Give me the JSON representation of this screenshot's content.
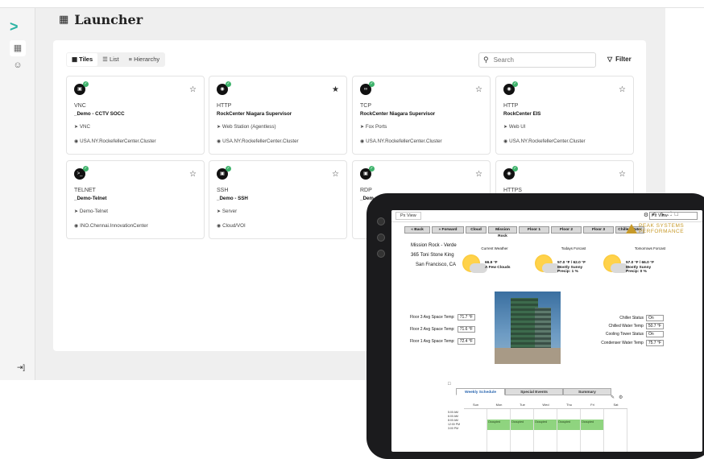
{
  "rail": {
    "items": [
      "launcher",
      "user"
    ]
  },
  "page": {
    "title": "Launcher"
  },
  "view_tabs": [
    {
      "label": "Tiles",
      "icon": "grid-icon",
      "active": true
    },
    {
      "label": "List",
      "icon": "list-icon",
      "active": false
    },
    {
      "label": "Hierarchy",
      "icon": "hierarchy-icon",
      "active": false
    }
  ],
  "search": {
    "placeholder": "Search"
  },
  "filter": {
    "label": "Filter"
  },
  "cards": [
    {
      "protocol": "VNC",
      "name": "_Demo - CCTV SOCC",
      "app": "VNC",
      "location": "USA.NY.RockefellerCenter.Cluster",
      "favorite": false
    },
    {
      "protocol": "HTTP",
      "name": "RockCenter Niagara Supervisor",
      "app": "Web Station (Agentless)",
      "location": "USA.NY.RockefellerCenter.Cluster",
      "favorite": true
    },
    {
      "protocol": "TCP",
      "name": "RockCenter Niagara Supervisor",
      "app": "Fox Ports",
      "location": "USA.NY.RockefellerCenter.Cluster",
      "favorite": false
    },
    {
      "protocol": "HTTP",
      "name": "RockCenter EIS",
      "app": "Web UI",
      "location": "USA.NY.RockefellerCenter.Cluster",
      "favorite": false
    },
    {
      "protocol": "TELNET",
      "name": "_Demo-Telnet",
      "app": "Demo-Telnet",
      "location": "INO.Chennai.InnovationCenter",
      "favorite": false
    },
    {
      "protocol": "SSH",
      "name": "_Demo - SSH",
      "app": "Server",
      "location": "Cloud/VOI",
      "favorite": false
    },
    {
      "protocol": "RDP",
      "name": "_Dem",
      "app": "",
      "location": "",
      "favorite": false
    },
    {
      "protocol": "HTTPS",
      "name": "",
      "app": "",
      "location": "",
      "favorite": false
    }
  ],
  "tablet": {
    "tab": "Px View",
    "view_select": "Px View",
    "nav_buttons": [
      "« Back",
      "» Forward",
      "Cloud",
      "Mission Rock",
      "Floor 1",
      "Floor 2",
      "Floor 3",
      "Chiller Water"
    ],
    "brand_line1": "PEAK SYSTEMS",
    "brand_line2": "PERFORMANCE",
    "address": [
      "Mission Rock - Verde",
      "365 Toni Stone King",
      "San Francisco, CA"
    ],
    "weather": [
      {
        "label": "Current Weather",
        "line1": "66.9 °F",
        "line2": "A Few Clouds",
        "line3": ""
      },
      {
        "label": "Todays Forcast",
        "line1": "57.0 °F / 62.0 °F",
        "line2": "Mostly Sunny",
        "line3": "Precip: 1 %"
      },
      {
        "label": "Tomorrows Forcast",
        "line1": "57.0 °F / 66.0 °F",
        "line2": "Mostly Sunny",
        "line3": "Precip: 0 %"
      }
    ],
    "temps": [
      {
        "label": "Floor 3 Avg Space Temp:",
        "value": "71.7 °F"
      },
      {
        "label": "Floor 2 Avg Space Temp:",
        "value": "71.6 °F"
      },
      {
        "label": "Floor 1 Avg Space Temp:",
        "value": "72.4 °F"
      }
    ],
    "status": [
      {
        "label": "Chiller Status",
        "value": "On"
      },
      {
        "label": "Chilled Water Temp",
        "value": "50.7 °F"
      },
      {
        "label": "Cooling Tower Status",
        "value": "On"
      },
      {
        "label": "Condenser Water Temp",
        "value": "75.7 °F"
      }
    ],
    "schedule": {
      "tabs": [
        "Weekly Schedule",
        "Special Events",
        "Summary"
      ],
      "days": [
        "Sun",
        "Mon",
        "Tue",
        "Wed",
        "Thu",
        "Fri",
        "Sat"
      ],
      "times": [
        "5:00 AM",
        "6:00 AM",
        "8:00 AM",
        "12:00 PM",
        "3:00 PM"
      ],
      "occupied_label": "Occupied"
    }
  }
}
